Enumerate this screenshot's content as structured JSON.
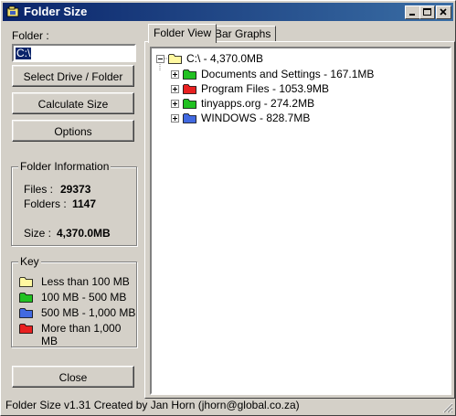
{
  "window": {
    "title": "Folder Size"
  },
  "sidebar": {
    "folder_label": "Folder :",
    "folder_value": "C:\\",
    "select_drive_button": "Select Drive / Folder",
    "calculate_button": "Calculate Size",
    "options_button": "Options",
    "close_button": "Close"
  },
  "info": {
    "title": "Folder Information",
    "files_label": "Files :",
    "files_value": "29373",
    "folders_label": "Folders :",
    "folders_value": "1147",
    "size_label": "Size :",
    "size_value": "4,370.0MB"
  },
  "key": {
    "title": "Key",
    "items": [
      {
        "label": "Less than 100 MB",
        "color": "#fff8a0"
      },
      {
        "label": "100 MB - 500 MB",
        "color": "#21c121"
      },
      {
        "label": "500 MB - 1,000 MB",
        "color": "#4169e1"
      },
      {
        "label": "More than 1,000 MB",
        "color": "#e82020"
      }
    ]
  },
  "tabs": [
    {
      "label": "Folder View",
      "active": true
    },
    {
      "label": "Bar Graphs",
      "active": false
    }
  ],
  "tree": {
    "root": {
      "label": "C:\\ - 4,370.0MB",
      "color": "#fff8a0"
    },
    "children": [
      {
        "label": "Documents and Settings - 167.1MB",
        "color": "#21c121"
      },
      {
        "label": "Program Files - 1053.9MB",
        "color": "#e82020"
      },
      {
        "label": "tinyapps.org - 274.2MB",
        "color": "#21c121"
      },
      {
        "label": "WINDOWS - 828.7MB",
        "color": "#4169e1"
      }
    ]
  },
  "status": "Folder Size v1.31    Created by Jan Horn    (jhorn@global.co.za)"
}
